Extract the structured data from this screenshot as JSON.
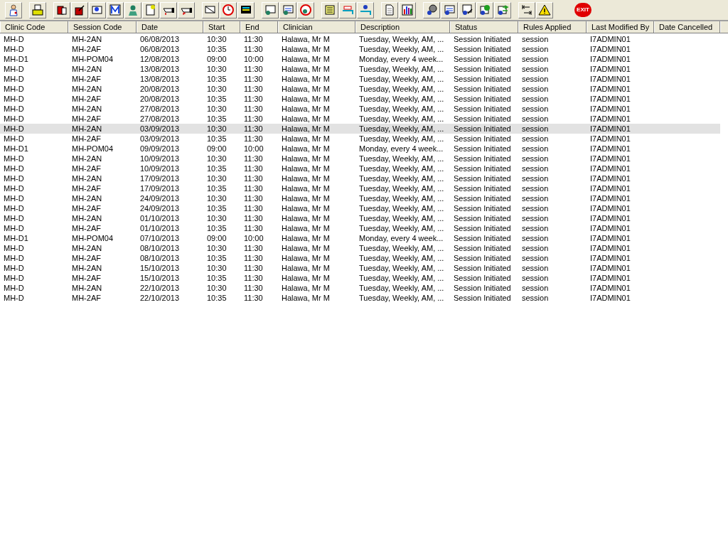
{
  "toolbar": {
    "exit_label": "EXIT"
  },
  "table": {
    "columns": [
      "Clinic Code",
      "Session Code",
      "Date",
      "Start",
      "End",
      "Clinician",
      "Description",
      "Status",
      "Rules Applied",
      "Last Modified By",
      "Date Cancelled"
    ],
    "rows": [
      {
        "cells": [
          "MH-D",
          "MH-2AN",
          "06/08/2013",
          "10:30",
          "11:30",
          "Halawa, Mr M",
          "Tuesday, Weekly, AM, ...",
          "Session Initiated",
          "session",
          "I7ADMIN01"
        ],
        "selected": false
      },
      {
        "cells": [
          "MH-D",
          "MH-2AF",
          "06/08/2013",
          "10:35",
          "11:30",
          "Halawa, Mr M",
          "Tuesday, Weekly, AM, ...",
          "Session Initiated",
          "session",
          "I7ADMIN01"
        ],
        "selected": false
      },
      {
        "cells": [
          "MH-D1",
          "MH-POM04",
          "12/08/2013",
          "09:00",
          "10:00",
          "Halawa, Mr M",
          "Monday, every 4 week...",
          "Session Initiated",
          "session",
          "I7ADMIN01"
        ],
        "selected": false
      },
      {
        "cells": [
          "MH-D",
          "MH-2AN",
          "13/08/2013",
          "10:30",
          "11:30",
          "Halawa, Mr M",
          "Tuesday, Weekly, AM, ...",
          "Session Initiated",
          "session",
          "I7ADMIN01"
        ],
        "selected": false
      },
      {
        "cells": [
          "MH-D",
          "MH-2AF",
          "13/08/2013",
          "10:35",
          "11:30",
          "Halawa, Mr M",
          "Tuesday, Weekly, AM, ...",
          "Session Initiated",
          "session",
          "I7ADMIN01"
        ],
        "selected": false
      },
      {
        "cells": [
          "MH-D",
          "MH-2AN",
          "20/08/2013",
          "10:30",
          "11:30",
          "Halawa, Mr M",
          "Tuesday, Weekly, AM, ...",
          "Session Initiated",
          "session",
          "I7ADMIN01"
        ],
        "selected": false
      },
      {
        "cells": [
          "MH-D",
          "MH-2AF",
          "20/08/2013",
          "10:35",
          "11:30",
          "Halawa, Mr M",
          "Tuesday, Weekly, AM, ...",
          "Session Initiated",
          "session",
          "I7ADMIN01"
        ],
        "selected": false
      },
      {
        "cells": [
          "MH-D",
          "MH-2AN",
          "27/08/2013",
          "10:30",
          "11:30",
          "Halawa, Mr M",
          "Tuesday, Weekly, AM, ...",
          "Session Initiated",
          "session",
          "I7ADMIN01"
        ],
        "selected": false
      },
      {
        "cells": [
          "MH-D",
          "MH-2AF",
          "27/08/2013",
          "10:35",
          "11:30",
          "Halawa, Mr M",
          "Tuesday, Weekly, AM, ...",
          "Session Initiated",
          "session",
          "I7ADMIN01"
        ],
        "selected": false
      },
      {
        "cells": [
          "MH-D",
          "MH-2AN",
          "03/09/2013",
          "10:30",
          "11:30",
          "Halawa, Mr M",
          "Tuesday, Weekly, AM, ...",
          "Session Initiated",
          "session",
          "I7ADMIN01"
        ],
        "selected": true
      },
      {
        "cells": [
          "MH-D",
          "MH-2AF",
          "03/09/2013",
          "10:35",
          "11:30",
          "Halawa, Mr M",
          "Tuesday, Weekly, AM, ...",
          "Session Initiated",
          "session",
          "I7ADMIN01"
        ],
        "selected": false
      },
      {
        "cells": [
          "MH-D1",
          "MH-POM04",
          "09/09/2013",
          "09:00",
          "10:00",
          "Halawa, Mr M",
          "Monday, every 4 week...",
          "Session Initiated",
          "session",
          "I7ADMIN01"
        ],
        "selected": false
      },
      {
        "cells": [
          "MH-D",
          "MH-2AN",
          "10/09/2013",
          "10:30",
          "11:30",
          "Halawa, Mr M",
          "Tuesday, Weekly, AM, ...",
          "Session Initiated",
          "session",
          "I7ADMIN01"
        ],
        "selected": false
      },
      {
        "cells": [
          "MH-D",
          "MH-2AF",
          "10/09/2013",
          "10:35",
          "11:30",
          "Halawa, Mr M",
          "Tuesday, Weekly, AM, ...",
          "Session Initiated",
          "session",
          "I7ADMIN01"
        ],
        "selected": false
      },
      {
        "cells": [
          "MH-D",
          "MH-2AN",
          "17/09/2013",
          "10:30",
          "11:30",
          "Halawa, Mr M",
          "Tuesday, Weekly, AM, ...",
          "Session Initiated",
          "session",
          "I7ADMIN01"
        ],
        "selected": false
      },
      {
        "cells": [
          "MH-D",
          "MH-2AF",
          "17/09/2013",
          "10:35",
          "11:30",
          "Halawa, Mr M",
          "Tuesday, Weekly, AM, ...",
          "Session Initiated",
          "session",
          "I7ADMIN01"
        ],
        "selected": false
      },
      {
        "cells": [
          "MH-D",
          "MH-2AN",
          "24/09/2013",
          "10:30",
          "11:30",
          "Halawa, Mr M",
          "Tuesday, Weekly, AM, ...",
          "Session Initiated",
          "session",
          "I7ADMIN01"
        ],
        "selected": false
      },
      {
        "cells": [
          "MH-D",
          "MH-2AF",
          "24/09/2013",
          "10:35",
          "11:30",
          "Halawa, Mr M",
          "Tuesday, Weekly, AM, ...",
          "Session Initiated",
          "session",
          "I7ADMIN01"
        ],
        "selected": false
      },
      {
        "cells": [
          "MH-D",
          "MH-2AN",
          "01/10/2013",
          "10:30",
          "11:30",
          "Halawa, Mr M",
          "Tuesday, Weekly, AM, ...",
          "Session Initiated",
          "session",
          "I7ADMIN01"
        ],
        "selected": false
      },
      {
        "cells": [
          "MH-D",
          "MH-2AF",
          "01/10/2013",
          "10:35",
          "11:30",
          "Halawa, Mr M",
          "Tuesday, Weekly, AM, ...",
          "Session Initiated",
          "session",
          "I7ADMIN01"
        ],
        "selected": false
      },
      {
        "cells": [
          "MH-D1",
          "MH-POM04",
          "07/10/2013",
          "09:00",
          "10:00",
          "Halawa, Mr M",
          "Monday, every 4 week...",
          "Session Initiated",
          "session",
          "I7ADMIN01"
        ],
        "selected": false
      },
      {
        "cells": [
          "MH-D",
          "MH-2AN",
          "08/10/2013",
          "10:30",
          "11:30",
          "Halawa, Mr M",
          "Tuesday, Weekly, AM, ...",
          "Session Initiated",
          "session",
          "I7ADMIN01"
        ],
        "selected": false
      },
      {
        "cells": [
          "MH-D",
          "MH-2AF",
          "08/10/2013",
          "10:35",
          "11:30",
          "Halawa, Mr M",
          "Tuesday, Weekly, AM, ...",
          "Session Initiated",
          "session",
          "I7ADMIN01"
        ],
        "selected": false
      },
      {
        "cells": [
          "MH-D",
          "MH-2AN",
          "15/10/2013",
          "10:30",
          "11:30",
          "Halawa, Mr M",
          "Tuesday, Weekly, AM, ...",
          "Session Initiated",
          "session",
          "I7ADMIN01"
        ],
        "selected": false
      },
      {
        "cells": [
          "MH-D",
          "MH-2AF",
          "15/10/2013",
          "10:35",
          "11:30",
          "Halawa, Mr M",
          "Tuesday, Weekly, AM, ...",
          "Session Initiated",
          "session",
          "I7ADMIN01"
        ],
        "selected": false
      },
      {
        "cells": [
          "MH-D",
          "MH-2AN",
          "22/10/2013",
          "10:30",
          "11:30",
          "Halawa, Mr M",
          "Tuesday, Weekly, AM, ...",
          "Session Initiated",
          "session",
          "I7ADMIN01"
        ],
        "selected": false
      },
      {
        "cells": [
          "MH-D",
          "MH-2AF",
          "22/10/2013",
          "10:35",
          "11:30",
          "Halawa, Mr M",
          "Tuesday, Weekly, AM, ...",
          "Session Initiated",
          "session",
          "I7ADMIN01"
        ],
        "selected": false
      }
    ]
  }
}
